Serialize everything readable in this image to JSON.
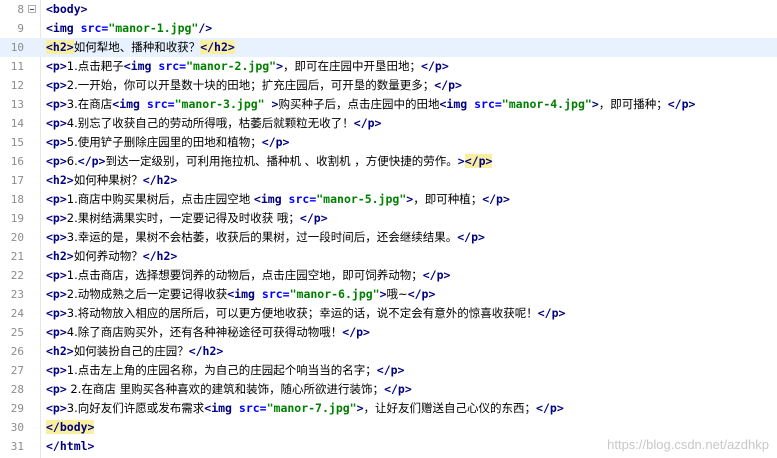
{
  "editor": {
    "current_line": 10,
    "watermark": "https://blog.csdn.net/azdhkp"
  },
  "lines": [
    {
      "n": "8",
      "fold": "minus",
      "seg": [
        [
          "tag",
          "<body>"
        ]
      ]
    },
    {
      "n": "9",
      "fold": "",
      "seg": [
        [
          "tag",
          "<img "
        ],
        [
          "attr",
          "src="
        ],
        [
          "val",
          "\"manor-1.jpg\""
        ],
        [
          "tag",
          "/>"
        ]
      ]
    },
    {
      "n": "10",
      "fold": "",
      "seg": [
        [
          "tagh",
          "<h2>"
        ],
        [
          "text",
          "如何犁地、播种和收获？"
        ],
        [
          "tagh",
          "</h2>"
        ]
      ]
    },
    {
      "n": "11",
      "fold": "",
      "seg": [
        [
          "tag",
          "<p>"
        ],
        [
          "text",
          "1.点击耙子"
        ],
        [
          "tag",
          "<img "
        ],
        [
          "attr",
          "src="
        ],
        [
          "val",
          "\"manor-2.jpg\""
        ],
        [
          "tag",
          ">"
        ],
        [
          "text",
          "，即可在庄园中开垦田地；"
        ],
        [
          "tag",
          "</p>"
        ]
      ]
    },
    {
      "n": "12",
      "fold": "",
      "seg": [
        [
          "tag",
          "<p>"
        ],
        [
          "text",
          "2.一开始，你可以开垦数十块的田地；扩充庄园后，可开垦的数量更多；"
        ],
        [
          "tag",
          "</p>"
        ]
      ]
    },
    {
      "n": "13",
      "fold": "",
      "seg": [
        [
          "tag",
          "<p>"
        ],
        [
          "text",
          "3.在商店"
        ],
        [
          "tag",
          "<img "
        ],
        [
          "attr",
          "src="
        ],
        [
          "val",
          "\"manor-3.jpg\" "
        ],
        [
          "tag",
          ">"
        ],
        [
          "text",
          "购买种子后，点击庄园中的田地"
        ],
        [
          "tag",
          "<img "
        ],
        [
          "attr",
          "src="
        ],
        [
          "val",
          "\"manor-4.jpg\""
        ],
        [
          "tag",
          ">"
        ],
        [
          "text",
          "，即可播种；"
        ],
        [
          "tag",
          "</p>"
        ]
      ]
    },
    {
      "n": "14",
      "fold": "",
      "seg": [
        [
          "tag",
          "<p>"
        ],
        [
          "text",
          "4.别忘了收获自己的劳动所得哦，枯萎后就颗粒无收了！"
        ],
        [
          "tag",
          "</p>"
        ]
      ]
    },
    {
      "n": "15",
      "fold": "",
      "seg": [
        [
          "tag",
          "<p>"
        ],
        [
          "text",
          "5.使用铲子删除庄园里的田地和植物；"
        ],
        [
          "tag",
          "</p>"
        ]
      ]
    },
    {
      "n": "16",
      "fold": "",
      "seg": [
        [
          "tag",
          "<p>"
        ],
        [
          "text",
          "6."
        ],
        [
          "tag",
          "</p>"
        ],
        [
          "text",
          "到达一定级别，可利用拖拉机、播种机 、收割机 ，方便快捷的劳作。"
        ],
        [
          "tag",
          ">"
        ],
        [
          "tagh",
          "</p>"
        ]
      ]
    },
    {
      "n": "17",
      "fold": "",
      "seg": [
        [
          "tag",
          "<h2>"
        ],
        [
          "text",
          "如何种果树？"
        ],
        [
          "tag",
          "</h2>"
        ]
      ]
    },
    {
      "n": "18",
      "fold": "",
      "seg": [
        [
          "tag",
          "<p>"
        ],
        [
          "text",
          "1.商店中购买果树后，点击庄园空地 "
        ],
        [
          "tag",
          "<img "
        ],
        [
          "attr",
          "src="
        ],
        [
          "val",
          "\"manor-5.jpg\""
        ],
        [
          "tag",
          ">"
        ],
        [
          "text",
          "，即可种植；"
        ],
        [
          "tag",
          "</p>"
        ]
      ]
    },
    {
      "n": "19",
      "fold": "",
      "seg": [
        [
          "tag",
          "<p>"
        ],
        [
          "text",
          "2.果树结满果实时，一定要记得及时收获 哦；"
        ],
        [
          "tag",
          "</p>"
        ]
      ]
    },
    {
      "n": "20",
      "fold": "",
      "seg": [
        [
          "tag",
          "<p>"
        ],
        [
          "text",
          "3.幸运的是，果树不会枯萎，收获后的果树，过一段时间后，还会继续结果。"
        ],
        [
          "tag",
          "</p>"
        ]
      ]
    },
    {
      "n": "21",
      "fold": "",
      "seg": [
        [
          "tag",
          "<h2>"
        ],
        [
          "text",
          "如何养动物？"
        ],
        [
          "tag",
          "</h2>"
        ]
      ]
    },
    {
      "n": "22",
      "fold": "",
      "seg": [
        [
          "tag",
          "<p>"
        ],
        [
          "text",
          "1.点击商店，选择想要饲养的动物后，点击庄园空地，即可饲养动物；"
        ],
        [
          "tag",
          "</p>"
        ]
      ]
    },
    {
      "n": "23",
      "fold": "",
      "seg": [
        [
          "tag",
          "<p>"
        ],
        [
          "text",
          "2.动物成熟之后一定要记得收获"
        ],
        [
          "tag",
          "<img "
        ],
        [
          "attr",
          "src="
        ],
        [
          "val",
          "\"manor-6.jpg\""
        ],
        [
          "tag",
          ">"
        ],
        [
          "text",
          "哦~"
        ],
        [
          "tag",
          "</p>"
        ]
      ]
    },
    {
      "n": "24",
      "fold": "",
      "seg": [
        [
          "tag",
          "<p>"
        ],
        [
          "text",
          "3.将动物放入相应的居所后，可以更方便地收获；幸运的话，说不定会有意外的惊喜收获呢！"
        ],
        [
          "tag",
          "</p>"
        ]
      ]
    },
    {
      "n": "25",
      "fold": "",
      "seg": [
        [
          "tag",
          "<p>"
        ],
        [
          "text",
          "4.除了商店购买外，还有各种神秘途径可获得动物哦！"
        ],
        [
          "tag",
          "</p>"
        ]
      ]
    },
    {
      "n": "26",
      "fold": "",
      "seg": [
        [
          "tag",
          "<h2>"
        ],
        [
          "text",
          "如何装扮自己的庄园？"
        ],
        [
          "tag",
          "</h2>"
        ]
      ]
    },
    {
      "n": "27",
      "fold": "",
      "seg": [
        [
          "tag",
          "<p>"
        ],
        [
          "text",
          "1.点击左上角的庄园名称，为自己的庄园起个响当当的名字；"
        ],
        [
          "tag",
          "</p>"
        ]
      ]
    },
    {
      "n": "28",
      "fold": "",
      "seg": [
        [
          "tag",
          "<p>"
        ],
        [
          "text",
          " 2.在商店 里购买各种喜欢的建筑和装饰，随心所欲进行装饰；"
        ],
        [
          "tag",
          "</p>"
        ]
      ]
    },
    {
      "n": "29",
      "fold": "",
      "seg": [
        [
          "tag",
          "<p>"
        ],
        [
          "text",
          "3.向好友们许愿或发布需求"
        ],
        [
          "tag",
          "<img "
        ],
        [
          "attr",
          "src="
        ],
        [
          "val",
          "\"manor-7.jpg\""
        ],
        [
          "tag",
          ">"
        ],
        [
          "text",
          "，让好友们赠送自己心仪的东西；"
        ],
        [
          "tag",
          "</p>"
        ]
      ]
    },
    {
      "n": "30",
      "fold": "",
      "seg": [
        [
          "tagh",
          "</body>"
        ]
      ]
    },
    {
      "n": "31",
      "fold": "",
      "seg": [
        [
          "tag",
          "</html>"
        ]
      ]
    }
  ]
}
